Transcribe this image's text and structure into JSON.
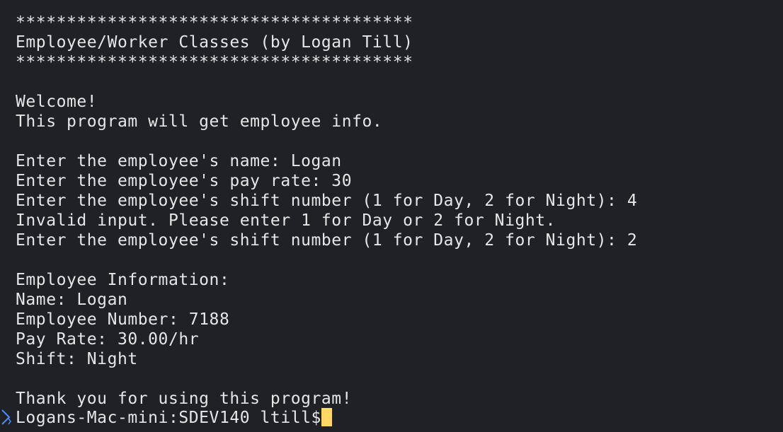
{
  "terminal": {
    "lines": [
      "***************************************",
      "Employee/Worker Classes (by Logan Till)",
      "***************************************",
      "",
      "Welcome!",
      "This program will get employee info.",
      "",
      "Enter the employee's name: Logan",
      "Enter the employee's pay rate: 30",
      "Enter the employee's shift number (1 for Day, 2 for Night): 4",
      "Invalid input. Please enter 1 for Day or 2 for Night.",
      "Enter the employee's shift number (1 for Day, 2 for Night): 2",
      "",
      "Employee Information:",
      "Name: Logan",
      "Employee Number: 7188",
      "Pay Rate: 30.00/hr",
      "Shift: Night",
      "",
      "Thank you for using this program!"
    ],
    "prompt": "Logans-Mac-mini:SDEV140 ltill$ ",
    "cursor_color": "#ffd866",
    "background_color": "#1f2127",
    "text_color": "#e6e6e6",
    "marker_icon": "command-marker-icon"
  }
}
